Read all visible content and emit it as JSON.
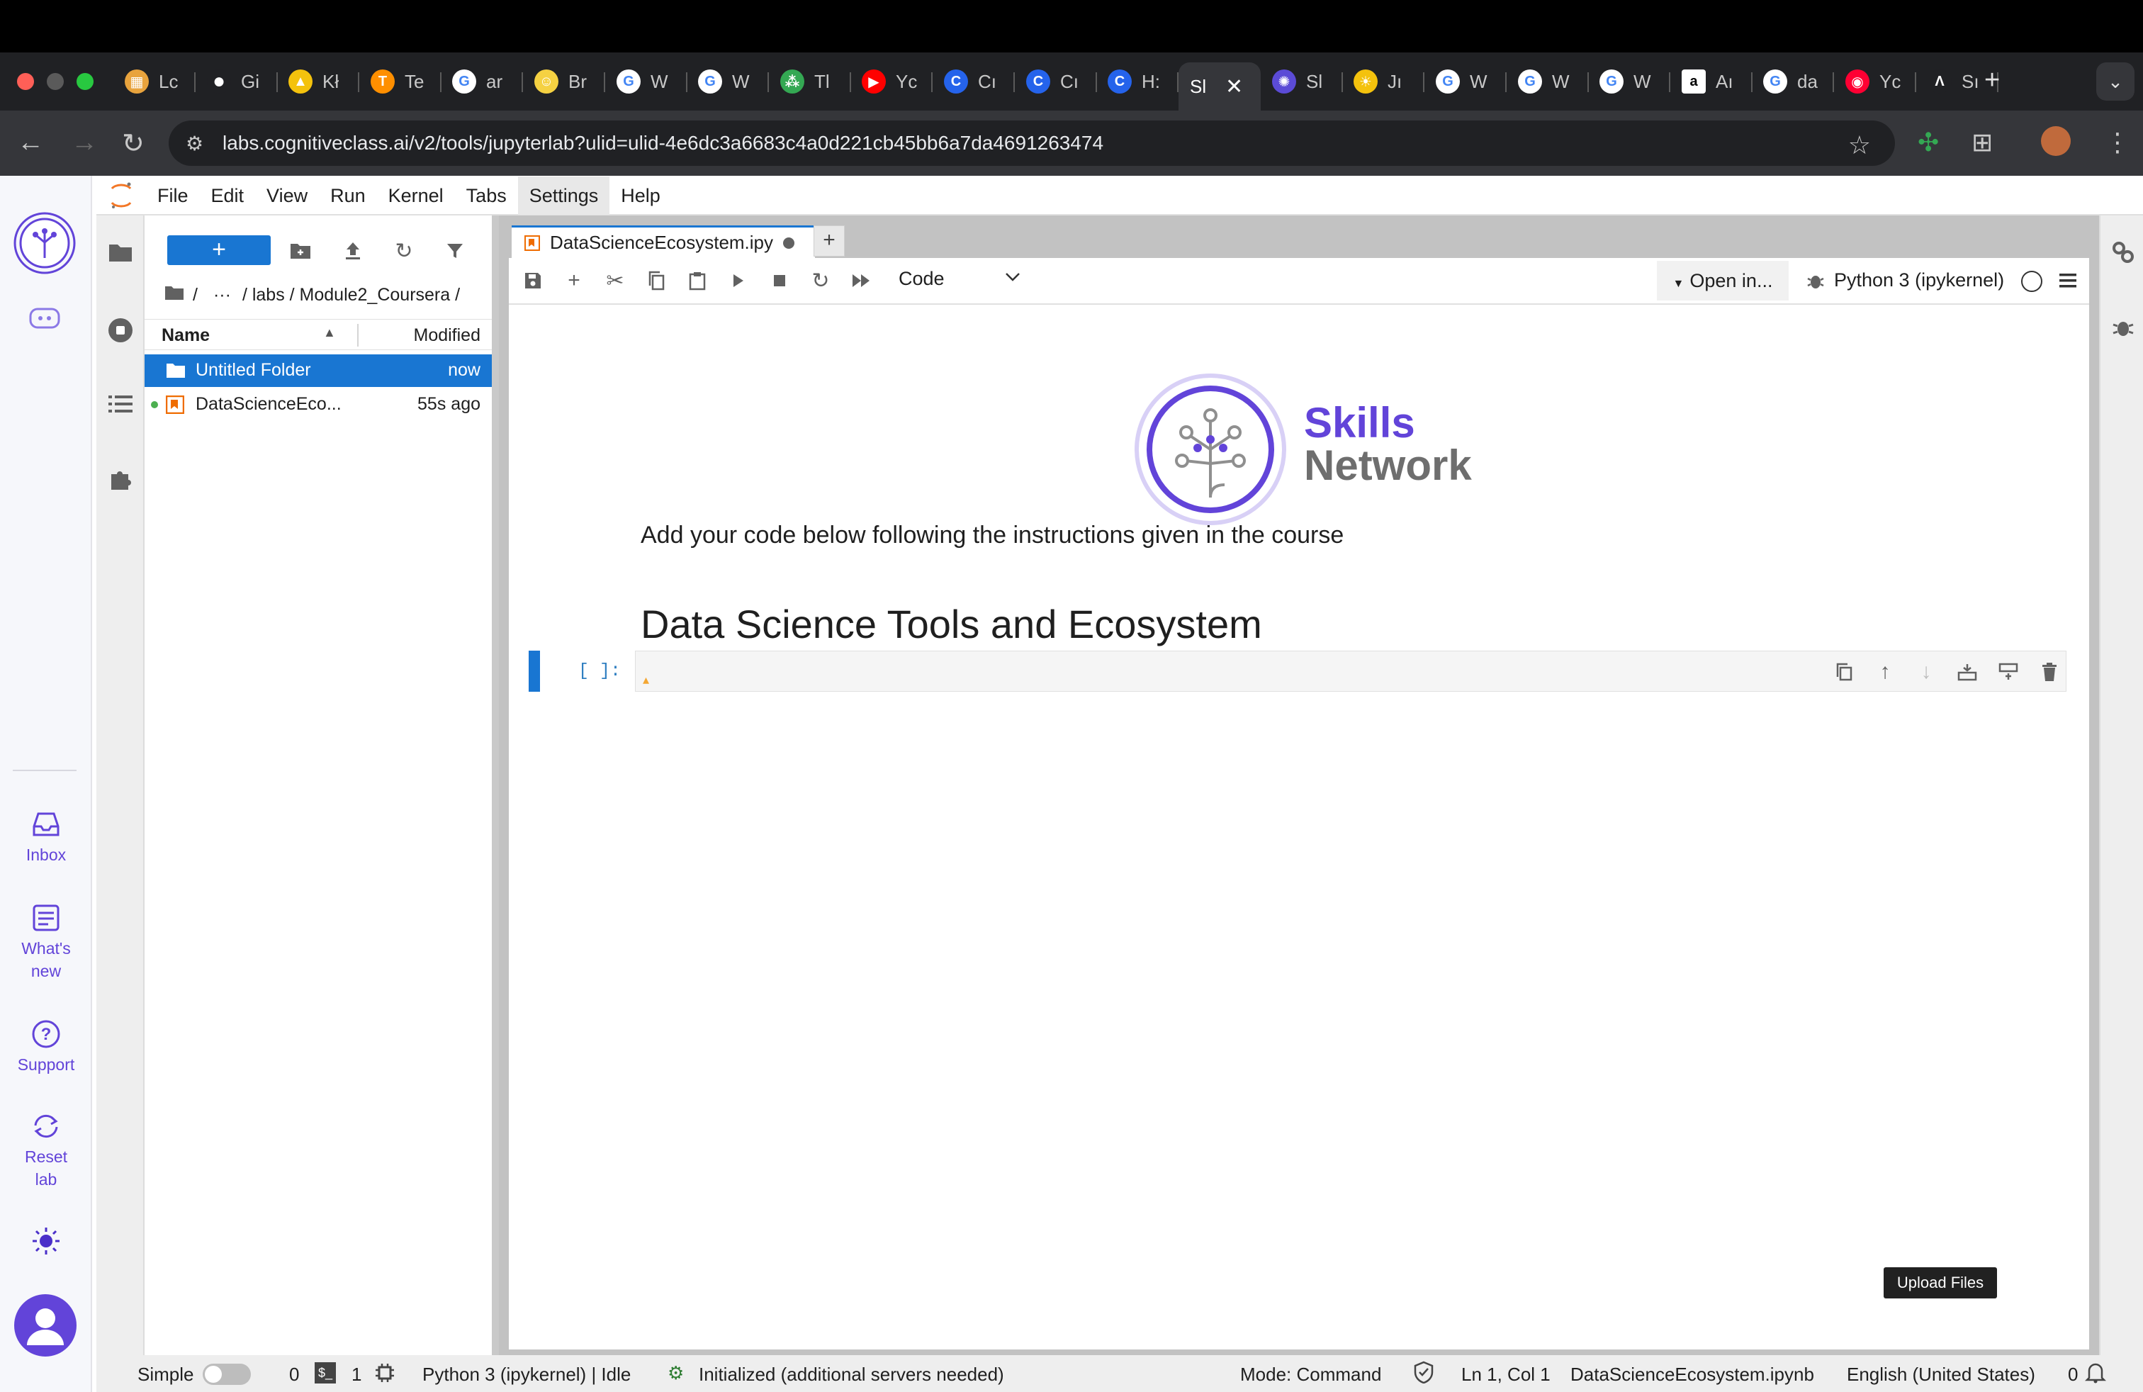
{
  "browser": {
    "tabs": [
      {
        "title": "Lc",
        "icon": "grid-icon",
        "color": "#e8a33d"
      },
      {
        "title": "Gi",
        "icon": "github-icon",
        "color": "#ffffff"
      },
      {
        "title": "Kł",
        "icon": "warning-triangle-icon",
        "color": "#f4c20d"
      },
      {
        "title": "Te",
        "icon": "tensorflow-icon",
        "color": "#ff8f00"
      },
      {
        "title": "ar",
        "icon": "google-icon",
        "color": "#4285f4"
      },
      {
        "title": "Br",
        "icon": "smiley-icon",
        "color": "#f5d142"
      },
      {
        "title": "W",
        "icon": "google-icon",
        "color": "#4285f4"
      },
      {
        "title": "W",
        "icon": "google-icon",
        "color": "#4285f4"
      },
      {
        "title": "Tl",
        "icon": "dots-icon",
        "color": "#34a853"
      },
      {
        "title": "Yc",
        "icon": "youtube-icon",
        "color": "#ff0000"
      },
      {
        "title": "Cı",
        "icon": "c-icon",
        "color": "#2563eb"
      },
      {
        "title": "Cı",
        "icon": "c-icon",
        "color": "#2563eb"
      },
      {
        "title": "H:",
        "icon": "c-icon",
        "color": "#2563eb"
      },
      {
        "title": "Sl",
        "icon": "none",
        "color": "#35363a",
        "active": true
      },
      {
        "title": "Sl",
        "icon": "skills-network-icon",
        "color": "#5b4bd6"
      },
      {
        "title": "Jı",
        "icon": "bulb-icon",
        "color": "#f4c20d"
      },
      {
        "title": "W",
        "icon": "google-icon",
        "color": "#4285f4"
      },
      {
        "title": "W",
        "icon": "google-icon",
        "color": "#4285f4"
      },
      {
        "title": "W",
        "icon": "google-icon",
        "color": "#4285f4"
      },
      {
        "title": "Aı",
        "icon": "amazon-icon",
        "color": "#ffffff"
      },
      {
        "title": "da",
        "icon": "google-icon",
        "color": "#4285f4"
      },
      {
        "title": "Yc",
        "icon": "youtube-music-icon",
        "color": "#ff0033"
      },
      {
        "title": "Sı",
        "icon": "arch-icon",
        "color": "#ffffff"
      }
    ],
    "url": "labs.cognitiveclass.ai/v2/tools/jupyterlab?ulid=ulid-4e6dc3a6683c4a0d221cb45bb6a7da4691263474"
  },
  "rail": {
    "inbox": "Inbox",
    "whats_new_1": "What's",
    "whats_new_2": "new",
    "support": "Support",
    "reset_1": "Reset",
    "reset_2": "lab",
    "accent": "#6244d9"
  },
  "menubar": [
    "File",
    "Edit",
    "View",
    "Run",
    "Kernel",
    "Tabs",
    "Settings",
    "Help"
  ],
  "filebrowser": {
    "new_label": "+",
    "breadcrumb": [
      "/",
      "···",
      "/ labs / Module2_Coursera /"
    ],
    "col_name": "Name",
    "col_modified": "Modified",
    "files": [
      {
        "name": "Untitled Folder",
        "modified": "now",
        "type": "folder",
        "selected": true
      },
      {
        "name": "DataScienceEco...",
        "modified": "55s ago",
        "type": "notebook",
        "running": true
      }
    ]
  },
  "notebook": {
    "tab_title": "DataScienceEcosystem.ipy",
    "cell_type": "Code",
    "open_in": "Open in...",
    "kernel": "Python 3 (ipykernel)",
    "logo_line1": "Skills",
    "logo_line2": "Network",
    "instructions": "Add your code below following the instructions given in the course",
    "heading": "Data Science Tools and Ecosystem",
    "prompt": "[ ]:",
    "tooltip": "Upload Files"
  },
  "statusbar": {
    "mode_label": "Simple",
    "terminals": "0",
    "kernels": "1",
    "kernel_status": "Python 3 (ipykernel) | Idle",
    "lsp": "Initialized (additional servers needed)",
    "mode": "Mode: Command",
    "position": "Ln 1, Col 1",
    "filename": "DataScienceEcosystem.ipynb",
    "language": "English (United States)",
    "notifications": "0"
  }
}
